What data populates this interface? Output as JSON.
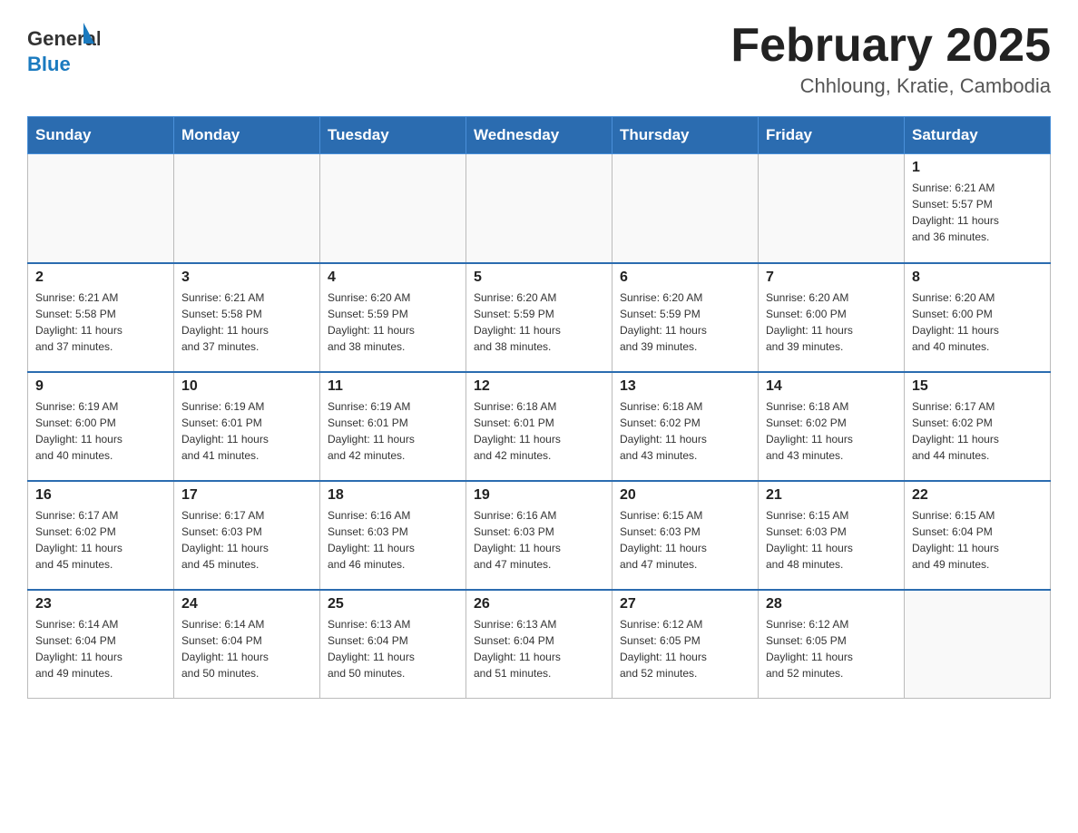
{
  "header": {
    "logo_general": "General",
    "logo_blue": "Blue",
    "title": "February 2025",
    "subtitle": "Chhloung, Kratie, Cambodia"
  },
  "days_of_week": [
    "Sunday",
    "Monday",
    "Tuesday",
    "Wednesday",
    "Thursday",
    "Friday",
    "Saturday"
  ],
  "weeks": [
    {
      "days": [
        {
          "number": "",
          "info": ""
        },
        {
          "number": "",
          "info": ""
        },
        {
          "number": "",
          "info": ""
        },
        {
          "number": "",
          "info": ""
        },
        {
          "number": "",
          "info": ""
        },
        {
          "number": "",
          "info": ""
        },
        {
          "number": "1",
          "info": "Sunrise: 6:21 AM\nSunset: 5:57 PM\nDaylight: 11 hours\nand 36 minutes."
        }
      ]
    },
    {
      "days": [
        {
          "number": "2",
          "info": "Sunrise: 6:21 AM\nSunset: 5:58 PM\nDaylight: 11 hours\nand 37 minutes."
        },
        {
          "number": "3",
          "info": "Sunrise: 6:21 AM\nSunset: 5:58 PM\nDaylight: 11 hours\nand 37 minutes."
        },
        {
          "number": "4",
          "info": "Sunrise: 6:20 AM\nSunset: 5:59 PM\nDaylight: 11 hours\nand 38 minutes."
        },
        {
          "number": "5",
          "info": "Sunrise: 6:20 AM\nSunset: 5:59 PM\nDaylight: 11 hours\nand 38 minutes."
        },
        {
          "number": "6",
          "info": "Sunrise: 6:20 AM\nSunset: 5:59 PM\nDaylight: 11 hours\nand 39 minutes."
        },
        {
          "number": "7",
          "info": "Sunrise: 6:20 AM\nSunset: 6:00 PM\nDaylight: 11 hours\nand 39 minutes."
        },
        {
          "number": "8",
          "info": "Sunrise: 6:20 AM\nSunset: 6:00 PM\nDaylight: 11 hours\nand 40 minutes."
        }
      ]
    },
    {
      "days": [
        {
          "number": "9",
          "info": "Sunrise: 6:19 AM\nSunset: 6:00 PM\nDaylight: 11 hours\nand 40 minutes."
        },
        {
          "number": "10",
          "info": "Sunrise: 6:19 AM\nSunset: 6:01 PM\nDaylight: 11 hours\nand 41 minutes."
        },
        {
          "number": "11",
          "info": "Sunrise: 6:19 AM\nSunset: 6:01 PM\nDaylight: 11 hours\nand 42 minutes."
        },
        {
          "number": "12",
          "info": "Sunrise: 6:18 AM\nSunset: 6:01 PM\nDaylight: 11 hours\nand 42 minutes."
        },
        {
          "number": "13",
          "info": "Sunrise: 6:18 AM\nSunset: 6:02 PM\nDaylight: 11 hours\nand 43 minutes."
        },
        {
          "number": "14",
          "info": "Sunrise: 6:18 AM\nSunset: 6:02 PM\nDaylight: 11 hours\nand 43 minutes."
        },
        {
          "number": "15",
          "info": "Sunrise: 6:17 AM\nSunset: 6:02 PM\nDaylight: 11 hours\nand 44 minutes."
        }
      ]
    },
    {
      "days": [
        {
          "number": "16",
          "info": "Sunrise: 6:17 AM\nSunset: 6:02 PM\nDaylight: 11 hours\nand 45 minutes."
        },
        {
          "number": "17",
          "info": "Sunrise: 6:17 AM\nSunset: 6:03 PM\nDaylight: 11 hours\nand 45 minutes."
        },
        {
          "number": "18",
          "info": "Sunrise: 6:16 AM\nSunset: 6:03 PM\nDaylight: 11 hours\nand 46 minutes."
        },
        {
          "number": "19",
          "info": "Sunrise: 6:16 AM\nSunset: 6:03 PM\nDaylight: 11 hours\nand 47 minutes."
        },
        {
          "number": "20",
          "info": "Sunrise: 6:15 AM\nSunset: 6:03 PM\nDaylight: 11 hours\nand 47 minutes."
        },
        {
          "number": "21",
          "info": "Sunrise: 6:15 AM\nSunset: 6:03 PM\nDaylight: 11 hours\nand 48 minutes."
        },
        {
          "number": "22",
          "info": "Sunrise: 6:15 AM\nSunset: 6:04 PM\nDaylight: 11 hours\nand 49 minutes."
        }
      ]
    },
    {
      "days": [
        {
          "number": "23",
          "info": "Sunrise: 6:14 AM\nSunset: 6:04 PM\nDaylight: 11 hours\nand 49 minutes."
        },
        {
          "number": "24",
          "info": "Sunrise: 6:14 AM\nSunset: 6:04 PM\nDaylight: 11 hours\nand 50 minutes."
        },
        {
          "number": "25",
          "info": "Sunrise: 6:13 AM\nSunset: 6:04 PM\nDaylight: 11 hours\nand 50 minutes."
        },
        {
          "number": "26",
          "info": "Sunrise: 6:13 AM\nSunset: 6:04 PM\nDaylight: 11 hours\nand 51 minutes."
        },
        {
          "number": "27",
          "info": "Sunrise: 6:12 AM\nSunset: 6:05 PM\nDaylight: 11 hours\nand 52 minutes."
        },
        {
          "number": "28",
          "info": "Sunrise: 6:12 AM\nSunset: 6:05 PM\nDaylight: 11 hours\nand 52 minutes."
        },
        {
          "number": "",
          "info": ""
        }
      ]
    }
  ]
}
